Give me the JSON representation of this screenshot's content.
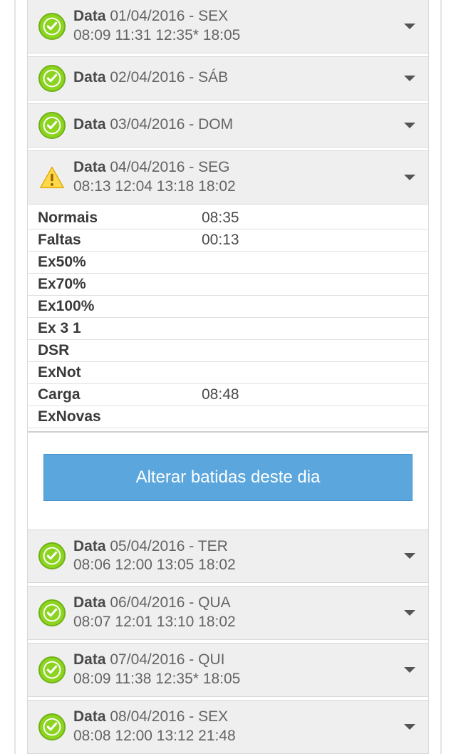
{
  "labels": {
    "data": "Data",
    "button": "Alterar batidas deste dia"
  },
  "entries": [
    {
      "date": "01/04/2016 - SEX",
      "times": "08:09 11:31 12:35* 18:05",
      "status": "ok"
    },
    {
      "date": "02/04/2016 - SÁB",
      "times": "",
      "status": "ok"
    },
    {
      "date": "03/04/2016 - DOM",
      "times": "",
      "status": "ok"
    },
    {
      "date": "04/04/2016 - SEG",
      "times": "08:13 12:04 13:18 18:02",
      "status": "warn",
      "expanded": true
    },
    {
      "date": "05/04/2016 - TER",
      "times": "08:06 12:00 13:05 18:02",
      "status": "ok"
    },
    {
      "date": "06/04/2016 - QUA",
      "times": "08:07 12:01 13:10 18:02",
      "status": "ok"
    },
    {
      "date": "07/04/2016 - QUI",
      "times": "08:09 11:38 12:35* 18:05",
      "status": "ok"
    },
    {
      "date": "08/04/2016 - SEX",
      "times": "08:08 12:00 13:12 21:48",
      "status": "ok"
    }
  ],
  "details": [
    {
      "key": "Normais",
      "value": "08:35"
    },
    {
      "key": "Faltas",
      "value": "00:13"
    },
    {
      "key": "Ex50%",
      "value": ""
    },
    {
      "key": "Ex70%",
      "value": ""
    },
    {
      "key": "Ex100%",
      "value": ""
    },
    {
      "key": "Ex 3 1",
      "value": ""
    },
    {
      "key": "DSR",
      "value": ""
    },
    {
      "key": "ExNot",
      "value": ""
    },
    {
      "key": "Carga",
      "value": "08:48"
    },
    {
      "key": "ExNovas",
      "value": ""
    }
  ]
}
